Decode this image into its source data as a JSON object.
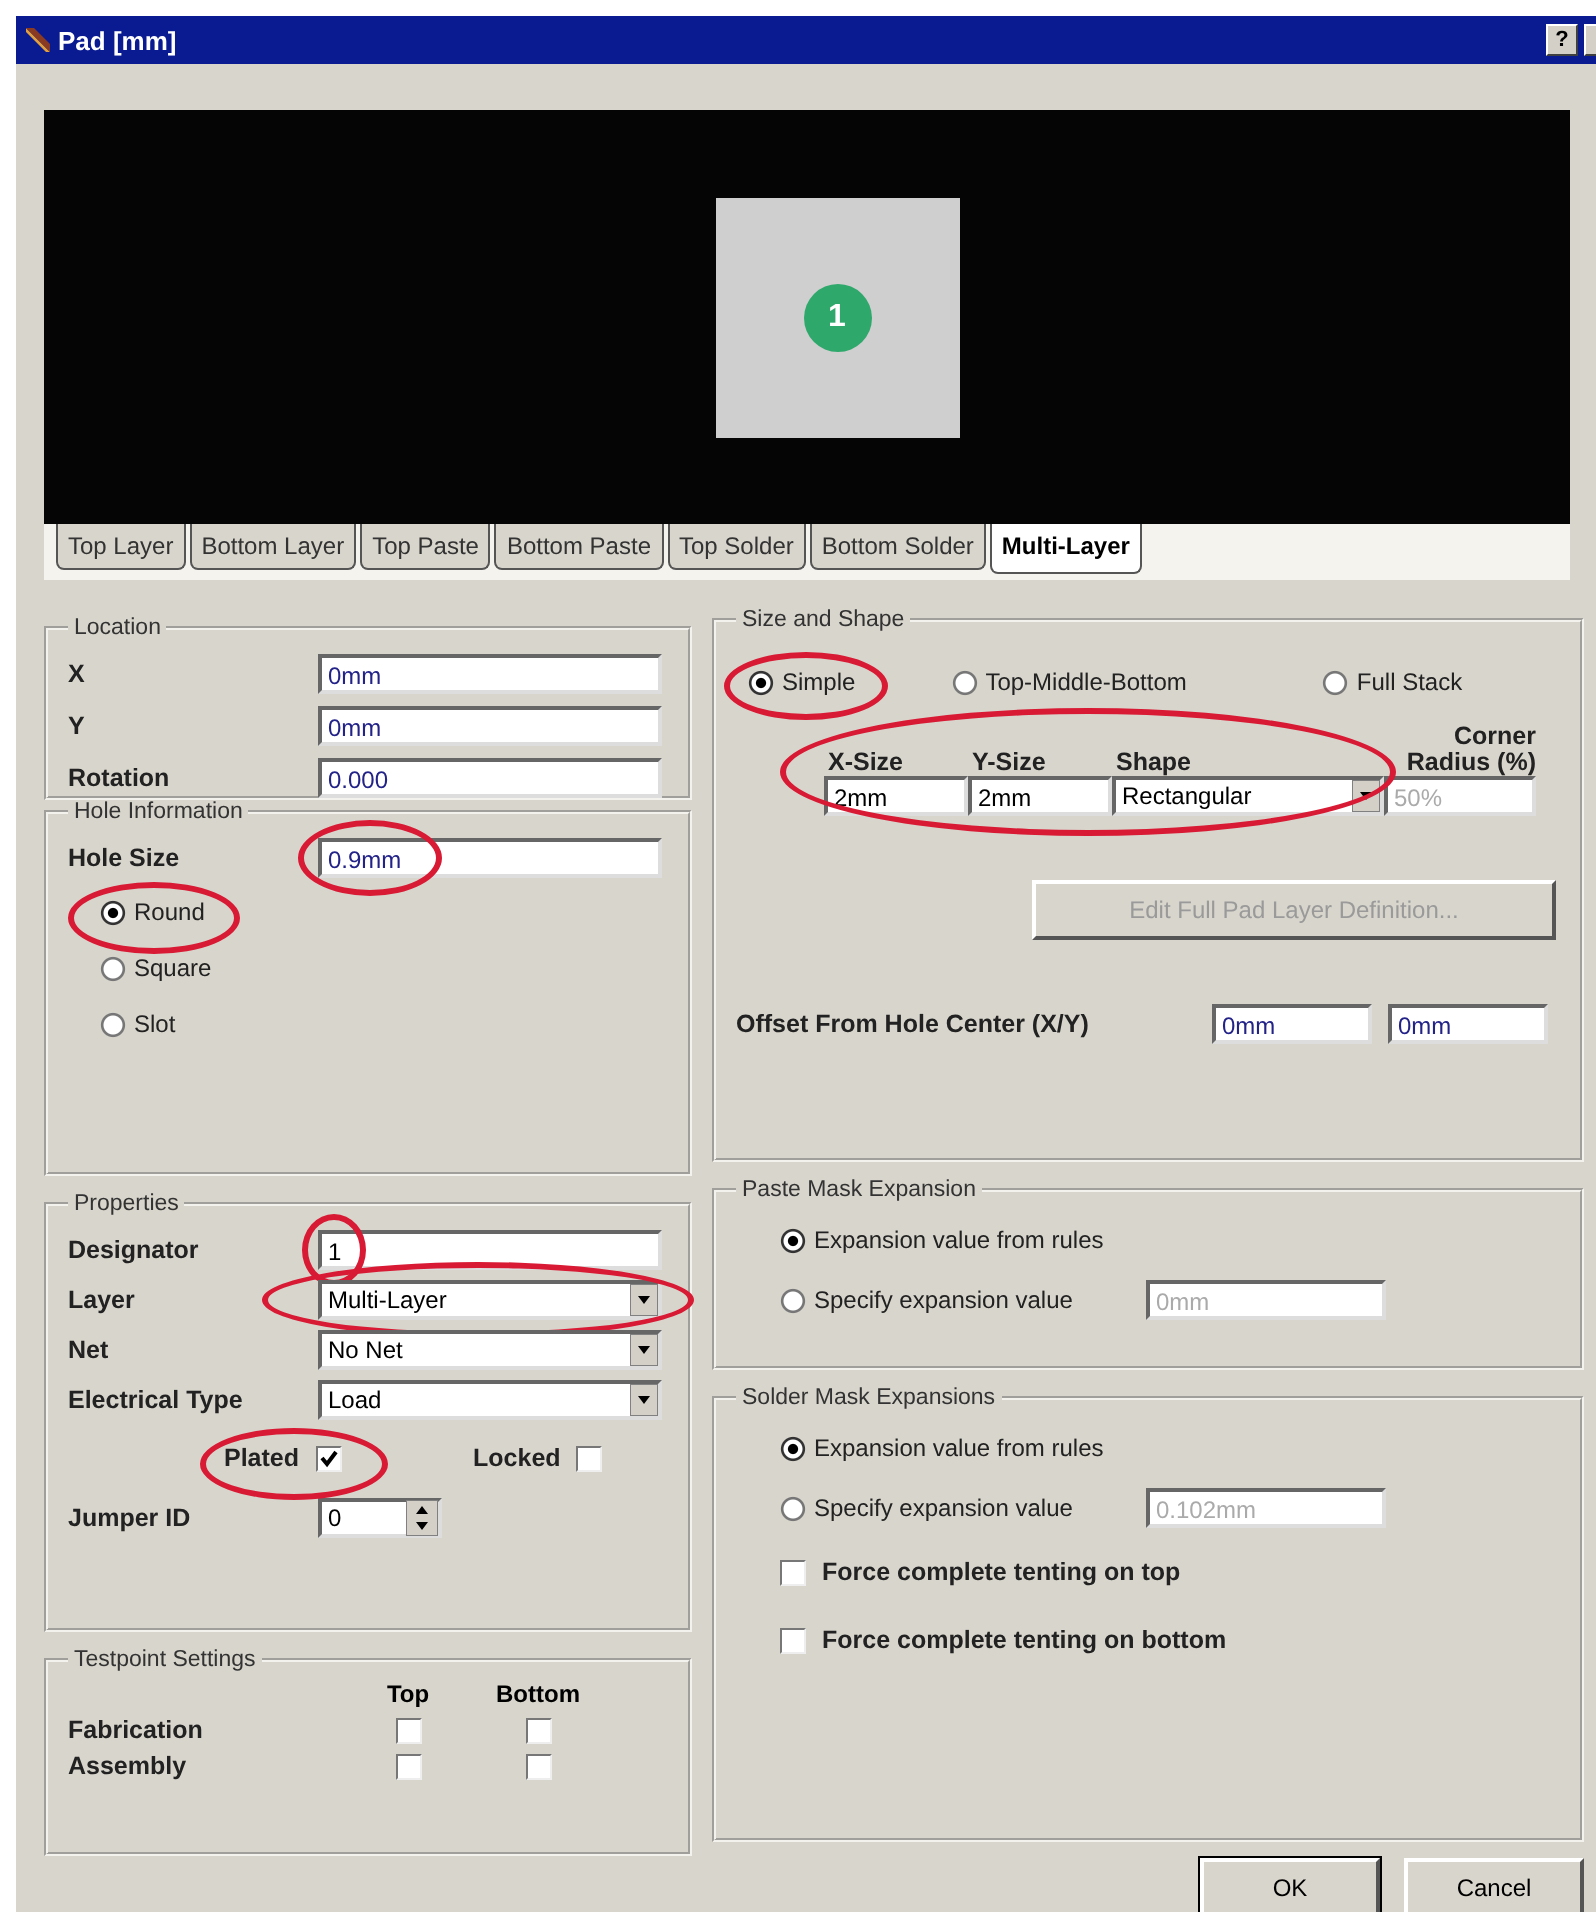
{
  "window": {
    "title": "Pad [mm]",
    "help_button": "?"
  },
  "preview": {
    "designator": "1"
  },
  "tabs": [
    {
      "label": "Top Layer",
      "selected": false
    },
    {
      "label": "Bottom Layer",
      "selected": false
    },
    {
      "label": "Top Paste",
      "selected": false
    },
    {
      "label": "Bottom Paste",
      "selected": false
    },
    {
      "label": "Top Solder",
      "selected": false
    },
    {
      "label": "Bottom Solder",
      "selected": false
    },
    {
      "label": "Multi-Layer",
      "selected": true
    }
  ],
  "location": {
    "title": "Location",
    "fields": [
      {
        "label": "X",
        "value": "0mm"
      },
      {
        "label": "Y",
        "value": "0mm"
      },
      {
        "label": "Rotation",
        "value": "0.000"
      }
    ]
  },
  "hole_information": {
    "title": "Hole Information",
    "hole_size": {
      "label": "Hole Size",
      "value": "0.9mm",
      "circled": true
    },
    "shapes": [
      {
        "label": "Round",
        "selected": true,
        "circled": true
      },
      {
        "label": "Square",
        "selected": false
      },
      {
        "label": "Slot",
        "selected": false
      }
    ]
  },
  "properties": {
    "title": "Properties",
    "rows": [
      {
        "kind": "text",
        "label": "Designator",
        "value": "1",
        "circled": true
      },
      {
        "kind": "dropdown",
        "label": "Layer",
        "value": "Multi-Layer",
        "circled": true
      },
      {
        "kind": "dropdown",
        "label": "Net",
        "value": "No Net"
      },
      {
        "kind": "dropdown",
        "label": "Electrical Type",
        "value": "Load"
      }
    ],
    "plated": {
      "label": "Plated",
      "checked": true,
      "circled": true
    },
    "locked": {
      "label": "Locked",
      "checked": false
    },
    "jumper_id": {
      "label": "Jumper ID",
      "value": "0"
    }
  },
  "testpoint": {
    "title": "Testpoint Settings",
    "columns": [
      "Top",
      "Bottom"
    ],
    "rows": [
      {
        "label": "Fabrication",
        "top": false,
        "bottom": false
      },
      {
        "label": "Assembly",
        "top": false,
        "bottom": false
      }
    ]
  },
  "size_and_shape": {
    "title": "Size and Shape",
    "modes": [
      {
        "label": "Simple",
        "selected": true,
        "circled": true
      },
      {
        "label": "Top-Middle-Bottom",
        "selected": false
      },
      {
        "label": "Full Stack",
        "selected": false
      }
    ],
    "grid_circled": true,
    "columns": [
      "X-Size",
      "Y-Size",
      "Shape",
      "Corner Radius (%)"
    ],
    "x_size": "2mm",
    "y_size": "2mm",
    "shape": "Rectangular",
    "corner_radius": "50%",
    "corner_radius_disabled": true,
    "edit_button": {
      "label": "Edit Full Pad Layer Definition...",
      "disabled": true
    },
    "offset": {
      "label": "Offset From Hole Center (X/Y)",
      "x": "0mm",
      "y": "0mm"
    }
  },
  "paste_mask": {
    "title": "Paste Mask Expansion",
    "options": [
      {
        "label": "Expansion value from rules",
        "selected": true
      },
      {
        "label": "Specify expansion value",
        "selected": false
      }
    ],
    "value": "0mm"
  },
  "solder_mask": {
    "title": "Solder Mask Expansions",
    "options": [
      {
        "label": "Expansion value from rules",
        "selected": true
      },
      {
        "label": "Specify expansion value",
        "selected": false
      }
    ],
    "value": "0.102mm",
    "tenting": [
      {
        "label": "Force complete tenting on top",
        "checked": false
      },
      {
        "label": "Force complete tenting on bottom",
        "checked": false
      }
    ]
  },
  "buttons": [
    {
      "label": "OK",
      "default": true
    },
    {
      "label": "Cancel",
      "default": false
    }
  ]
}
